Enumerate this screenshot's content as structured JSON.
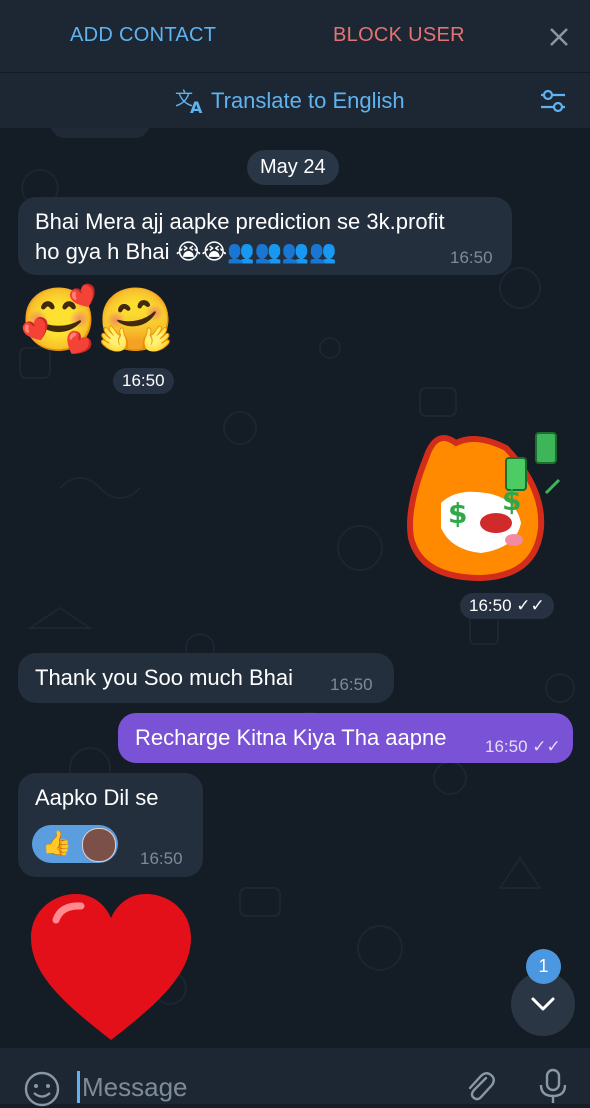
{
  "header": {
    "add_contact": "ADD CONTACT",
    "block_user": "BLOCK USER",
    "translate_label": "Translate to English"
  },
  "chat": {
    "date_chip": "May 24",
    "msg1": {
      "text_line1": "Bhai Mera ajj aapke prediction se 3k.profit",
      "text_line2": "ho gya h Bhai 😭😭👥👥👥👥",
      "time": "16:50"
    },
    "emoji_msg": {
      "emojis": "🥰🤗",
      "time": "16:50"
    },
    "sticker_msg": {
      "time": "16:50 ✓✓"
    },
    "msg2": {
      "text": "Thank you Soo much Bhai",
      "time": "16:50"
    },
    "msg3": {
      "text": "Recharge Kitna Kiya Tha aapne",
      "time": "16:50 ✓✓"
    },
    "msg4": {
      "text": "Aapko Dil se",
      "reaction": "👍",
      "time": "16:50"
    },
    "heart": "❤",
    "unread_badge": "1"
  },
  "composer": {
    "placeholder": "Message"
  },
  "colors": {
    "accent": "#5fb3f0",
    "danger": "#e57373",
    "outgoing_bubble": "#7a52d6",
    "incoming_bubble": "#242f3d"
  },
  "icons": [
    "close-icon",
    "translate-icon",
    "filter-icon",
    "chevron-down-icon",
    "emoji-icon",
    "paperclip-icon",
    "microphone-icon",
    "double-check-icon"
  ]
}
